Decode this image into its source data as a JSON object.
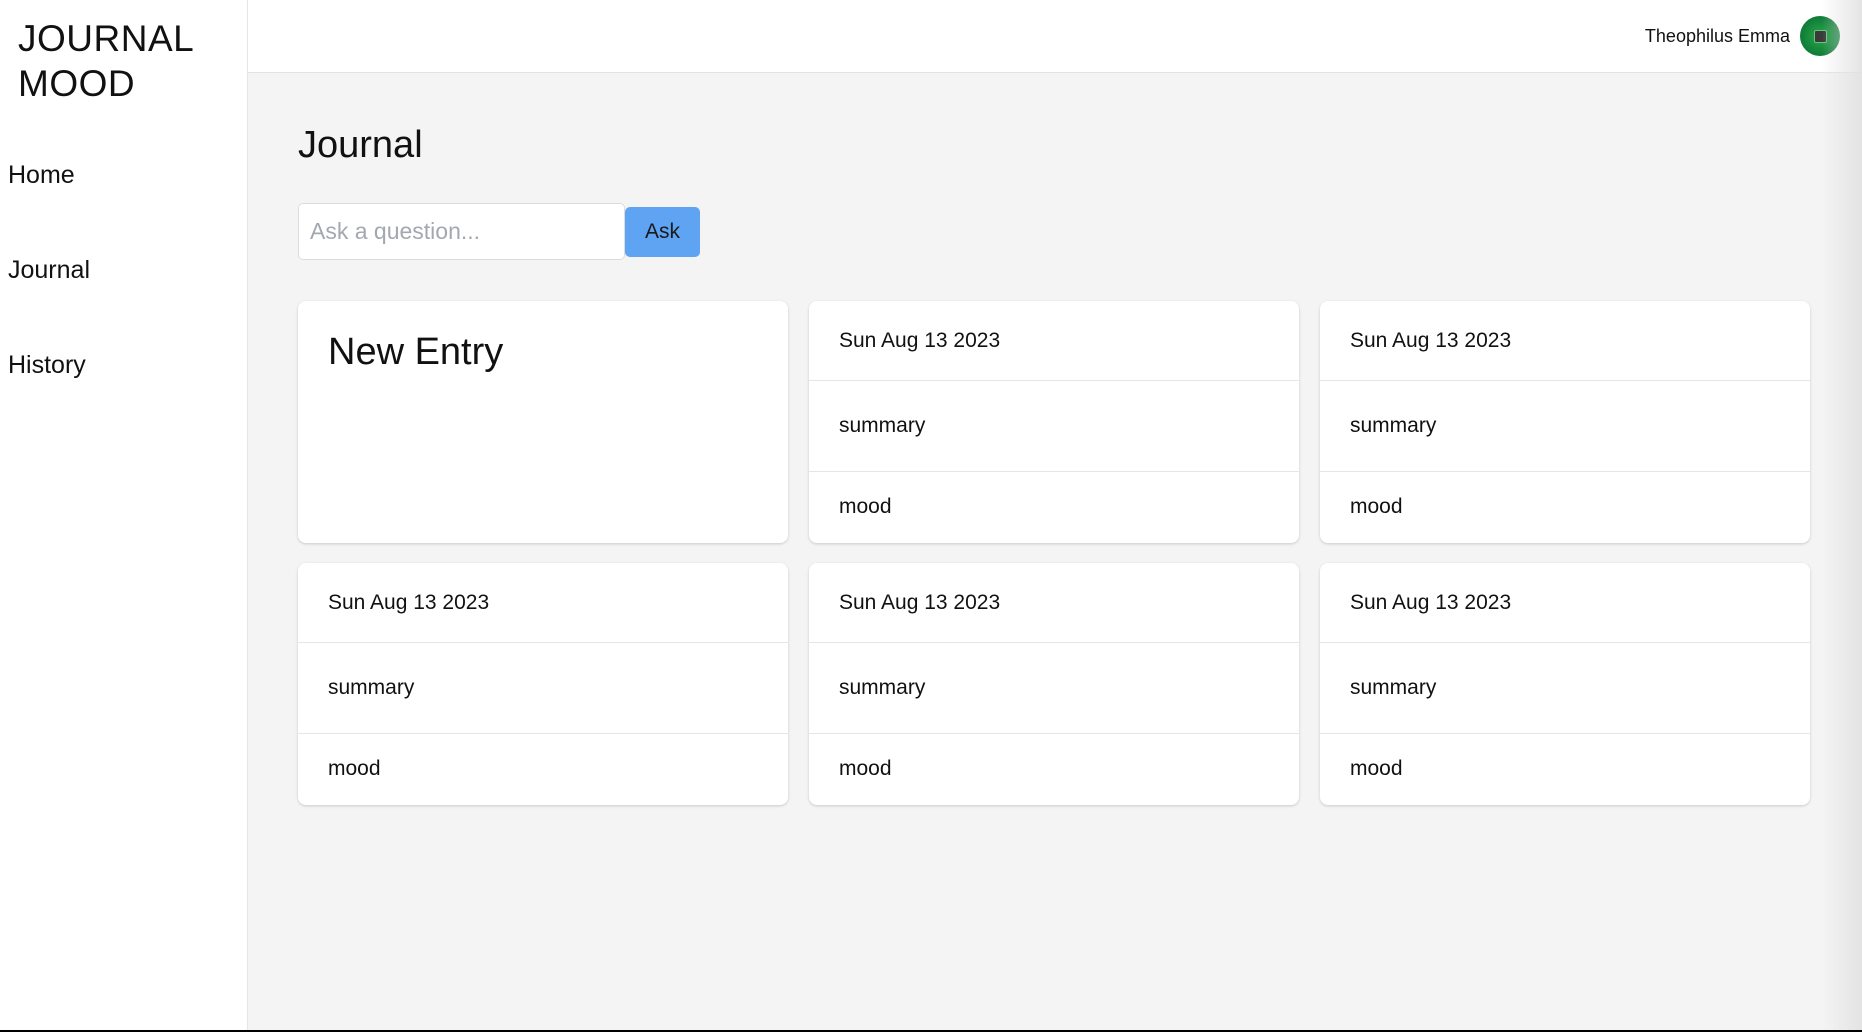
{
  "app": {
    "logo_line1": "JOURNAL",
    "logo_line2": "MOOD"
  },
  "sidebar": {
    "items": [
      {
        "label": "Home"
      },
      {
        "label": "Journal"
      },
      {
        "label": "History"
      }
    ]
  },
  "header": {
    "user_name": "Theophilus Emma",
    "avatar_color": "#12813a"
  },
  "main": {
    "title": "Journal",
    "ask": {
      "placeholder": "Ask a question...",
      "value": "",
      "button_label": "Ask",
      "button_color": "#5ea4f3"
    },
    "new_entry_label": "New Entry",
    "entries": [
      {
        "date": "Sun Aug 13 2023",
        "summary": "summary",
        "mood": "mood"
      },
      {
        "date": "Sun Aug 13 2023",
        "summary": "summary",
        "mood": "mood"
      },
      {
        "date": "Sun Aug 13 2023",
        "summary": "summary",
        "mood": "mood"
      },
      {
        "date": "Sun Aug 13 2023",
        "summary": "summary",
        "mood": "mood"
      },
      {
        "date": "Sun Aug 13 2023",
        "summary": "summary",
        "mood": "mood"
      }
    ]
  },
  "colors": {
    "background": "#f4f4f4",
    "card": "#ffffff",
    "accent": "#5ea4f3"
  }
}
